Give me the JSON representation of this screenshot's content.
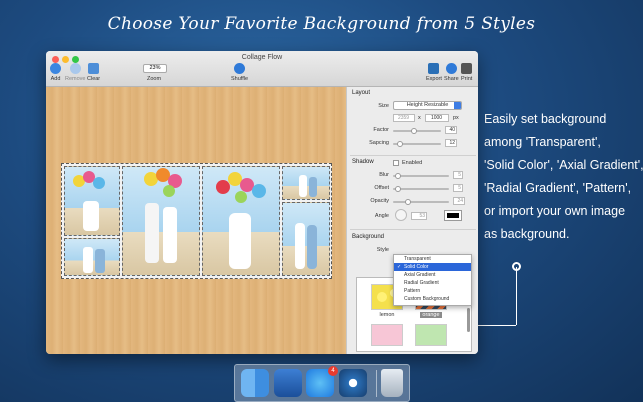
{
  "headline": "Choose Your Favorite Background from 5 Styles",
  "side_text": "Easily set background\namong 'Transparent',\n'Solid Color', 'Axial Gradient',\n'Radial Gradient', 'Pattern',\nor import your own image\nas background.",
  "window": {
    "title": "Collage Flow",
    "toolbar": {
      "add": "Add",
      "remove": "Remove",
      "clear": "Clear",
      "zoom_value": "23%",
      "zoom_label": "Zoom",
      "shuffle": "Shuffle",
      "export": "Export",
      "share": "Share",
      "print": "Print"
    }
  },
  "panel": {
    "layout": {
      "title": "Layout",
      "size_label": "Size",
      "size_value": "Height Resizable",
      "width": "2359",
      "x_sep": "x",
      "height": "1000",
      "unit": "px",
      "factor_label": "Factor",
      "factor_value": "40",
      "spacing_label": "Sapcing",
      "spacing_value": "12"
    },
    "shadow": {
      "title": "Shadow",
      "enabled_label": "Enabled",
      "blur_label": "Blur",
      "blur_value": "5",
      "offset_label": "Offset",
      "offset_value": "5",
      "opacity_label": "Opacity",
      "opacity_value": "24",
      "angle_label": "Angle",
      "angle_value": "53",
      "color": "#000000"
    },
    "background": {
      "title": "Background",
      "style_label": "Style",
      "options": [
        "Transparent",
        "Solid Color",
        "Axial Gradient",
        "Radial Gradient",
        "Pattern",
        "Custom Background"
      ],
      "selected": "Solid Color",
      "swatches": [
        {
          "label": "lemon",
          "color": "#f4e04d"
        },
        {
          "label": "orange",
          "color": "#e8733a"
        }
      ]
    }
  },
  "dock": {
    "badge": "4"
  },
  "colors": {
    "accent": "#2b66d9",
    "desktop": "#1d4b80"
  }
}
